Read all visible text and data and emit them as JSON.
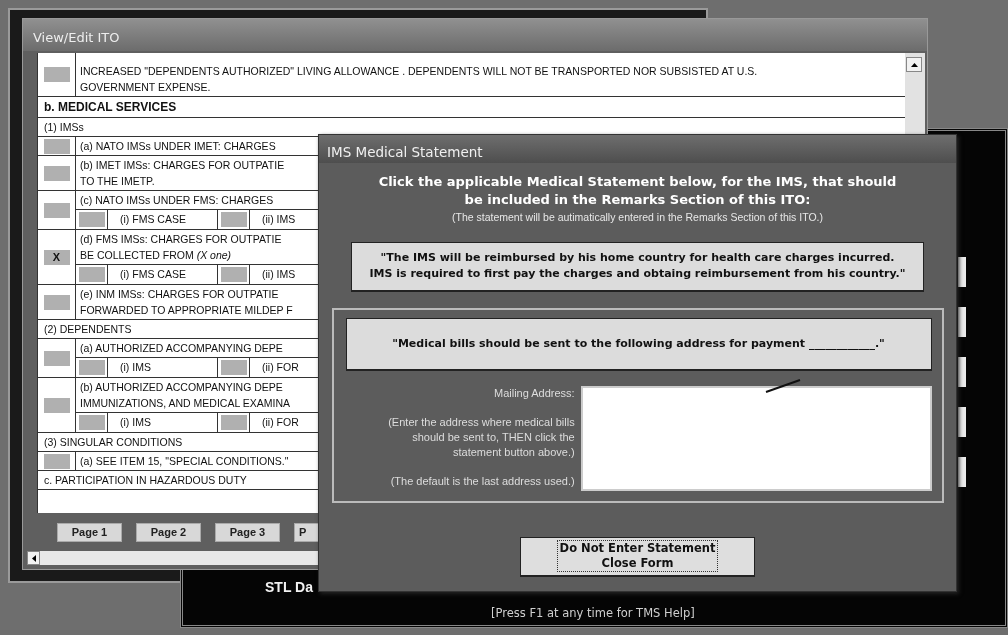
{
  "background": {
    "panel_title": "STL Da",
    "help_text": "[Press F1 at any time for TMS Help]"
  },
  "ito_window": {
    "title": "View/Edit ITO",
    "check_mark": "X",
    "rows": [
      {
        "kind": "item",
        "lines": [
          "INCREASED \"DEPENDENTS AUTHORIZED\" LIVING ALLOWANCE .  DEPENDENTS WILL NOT BE TRANSPORTED  NOR SUBSISTED AT U.S.",
          "GOVERNMENT EXPENSE."
        ],
        "checked": false
      },
      {
        "kind": "heading",
        "text": "b.  MEDICAL SERVICES"
      },
      {
        "kind": "label",
        "text": "(1) IMSs"
      },
      {
        "kind": "item",
        "lines": [
          "(a) NATO IMSs UNDER IMET: CHARGES"
        ],
        "checked": false
      },
      {
        "kind": "item",
        "lines": [
          "(b) IMET IMSs: CHARGES FOR OUTPATIE",
          "TO THE IMETP."
        ],
        "checked": false
      },
      {
        "kind": "item",
        "lines": [
          "(c) NATO IMSs UNDER FMS: CHARGES"
        ],
        "checked": false,
        "options": [
          {
            "label": "(i) FMS CASE",
            "checked": false
          },
          {
            "label": "(ii) IMS",
            "checked": false
          }
        ]
      },
      {
        "kind": "item",
        "lines": [
          "(d) FMS IMSs: CHARGES FOR OUTPATIE",
          "BE COLLECTED FROM       *(X one)*"
        ],
        "checked": true,
        "options": [
          {
            "label": "(i) FMS CASE",
            "checked": false
          },
          {
            "label": "(ii) IMS",
            "checked": false
          }
        ]
      },
      {
        "kind": "item",
        "lines": [
          "(e) INM IMSs: CHARGES FOR OUTPATIE",
          "FORWARDED TO APPROPRIATE MILDEP F"
        ],
        "checked": false
      },
      {
        "kind": "label",
        "text": "(2) DEPENDENTS"
      },
      {
        "kind": "item",
        "lines": [
          "(a) AUTHORIZED ACCOMPANYING DEPE"
        ],
        "checked": false,
        "options": [
          {
            "label": "(i) IMS",
            "checked": false
          },
          {
            "label": "(ii) FOR",
            "checked": false
          }
        ]
      },
      {
        "kind": "item",
        "lines": [
          "(b) AUTHORIZED ACCOMPANYING DEPE",
          "IMMUNIZATIONS, AND MEDICAL EXAMINA"
        ],
        "checked": false,
        "options": [
          {
            "label": "(i) IMS",
            "checked": false
          },
          {
            "label": "(ii) FOR",
            "checked": false
          }
        ]
      },
      {
        "kind": "label",
        "text": "(3) SINGULAR CONDITIONS"
      },
      {
        "kind": "item",
        "lines": [
          "(a) SEE ITEM 15, \"SPECIAL CONDITIONS.\""
        ],
        "checked": false
      },
      {
        "kind": "label",
        "text": "c. PARTICIPATION IN HAZARDOUS DUTY"
      }
    ],
    "page_buttons": [
      "Page 1",
      "Page 2",
      "Page 3",
      "P"
    ]
  },
  "dialog": {
    "title": "IMS Medical Statement",
    "heading_lines": [
      "Click the applicable Medical Statement below, for the IMS, that should",
      "be included in the Remarks Section of this ITO:"
    ],
    "subheading": "(The statement will be autimatically entered in the Remarks Section of this ITO.)",
    "statement_1": [
      "\"The IMS will be reimbursed by his home country for health care charges incurred.",
      "IMS is required to first pay the charges and obtaing reimbursement from his country.\""
    ],
    "statement_2": "\"Medical bills should be sent to the following address for payment ____________.\"",
    "address_label": "Mailing Address:",
    "address_hint": [
      "(Enter the address where medical bills",
      "should be sent to, THEN click the",
      "statement button above.)"
    ],
    "address_default_note": "(The default is the last address used.)",
    "close_button": {
      "lines": [
        "Do Not Enter Statement",
        "Close Form"
      ],
      "focused": true
    }
  }
}
